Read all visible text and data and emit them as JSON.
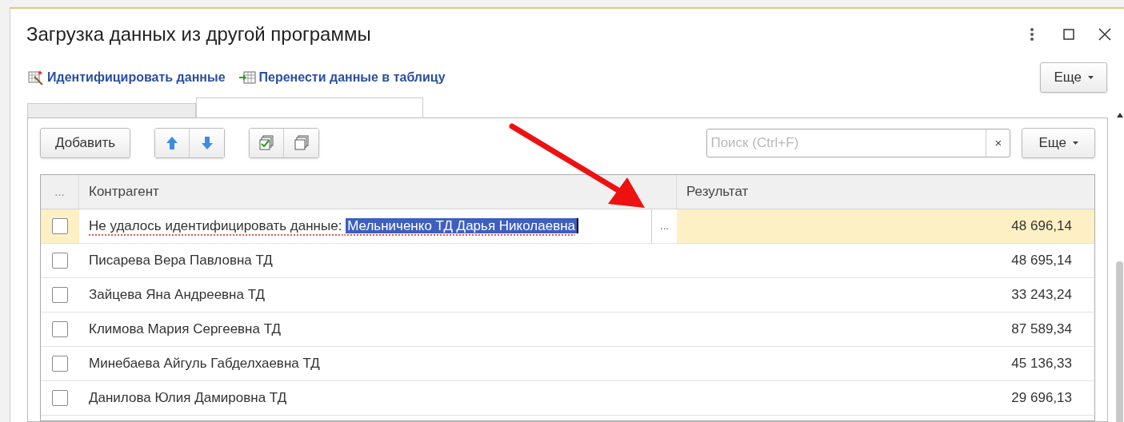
{
  "window": {
    "title": "Загрузка данных из другой программы"
  },
  "commands": [
    {
      "label": "Идентифицировать данные",
      "kind": "identify"
    },
    {
      "label": "Перенести данные в таблицу",
      "kind": "transfer"
    }
  ],
  "more_button": "Еще",
  "toolbar": {
    "add_button": "Добавить",
    "search": {
      "placeholder": "Поиск (Ctrl+F)"
    },
    "clear": "×",
    "more_button": "Еще"
  },
  "table": {
    "columns": [
      "...",
      "Контрагент",
      "Результат"
    ],
    "rows": [
      {
        "kind": "editing",
        "checked": false,
        "selected": true,
        "prefix": "Не удалось идентифицировать данные:",
        "contractor": "Мельниченко ТД Дарья Николаевна",
        "choice": "...",
        "result": "48 696,14"
      },
      {
        "kind": "plain",
        "checked": false,
        "selected": false,
        "contractor": "Писарева Вера Павловна ТД",
        "result": "48 695,14"
      },
      {
        "kind": "plain",
        "checked": false,
        "selected": false,
        "contractor": "Зайцева Яна Андреевна ТД",
        "result": "33 243,24"
      },
      {
        "kind": "plain",
        "checked": false,
        "selected": false,
        "contractor": "Климова Мария Сергеевна ТД",
        "result": "87 589,34"
      },
      {
        "kind": "plain",
        "checked": false,
        "selected": false,
        "contractor": "Минебаева Айгуль Габделхаевна ТД",
        "result": "45 136,33"
      },
      {
        "kind": "plain",
        "checked": false,
        "selected": false,
        "contractor": "Данилова Юлия Дамировна ТД",
        "result": "29 696,13"
      }
    ]
  }
}
